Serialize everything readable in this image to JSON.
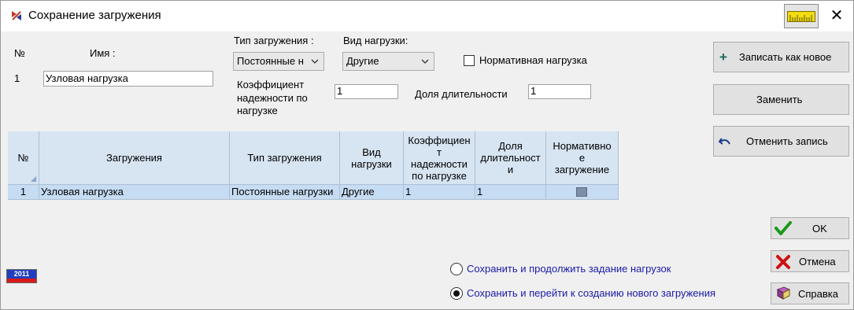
{
  "window": {
    "title": "Сохранение загружения",
    "close_glyph": "✕",
    "title_icon": "app-logo-icon",
    "ruler_icon": "ruler-icon"
  },
  "form": {
    "number_label": "№",
    "name_label": "Имя :",
    "row_number": "1",
    "name_value": "Узловая нагрузка",
    "load_type_label": "Тип загружения :",
    "load_type_value": "Постоянные н",
    "force_kind_label": "Вид нагрузки:",
    "force_kind_value": "Другие",
    "normative_label": "Нормативная нагрузка",
    "normative_checked": false,
    "reliability_label_1": "Коэффициент",
    "reliability_label_2": "надежности по",
    "reliability_label_3": "нагрузке",
    "reliability_value": "1",
    "duration_label": "Доля длительности",
    "duration_value": "1"
  },
  "grid": {
    "columns": [
      {
        "label": "№"
      },
      {
        "label": "Загружения"
      },
      {
        "label": "Тип загружения"
      },
      {
        "lines": [
          "Вид",
          "нагрузки"
        ]
      },
      {
        "lines": [
          "Коэффициен",
          "т",
          "надежности",
          "по нагрузке"
        ]
      },
      {
        "lines": [
          "Доля",
          "длительност",
          "и"
        ]
      },
      {
        "lines": [
          "Нормативно",
          "е",
          "загружение"
        ]
      }
    ],
    "rows": [
      {
        "num": "1",
        "name": "Узловая нагрузка",
        "type": "Постоянные нагрузки",
        "kind": "Другие",
        "reliability": "1",
        "duration": "1",
        "normative": false
      }
    ]
  },
  "buttons": {
    "save_new": "Записать как новое",
    "replace": "Заменить",
    "cancel_record": "Отменить запись",
    "ok": "OK",
    "cancel": "Отмена",
    "help": "Справка"
  },
  "radios": {
    "continue_label": "Сохранить и продолжить задание нагрузок",
    "new_label": "Сохранить и перейти к созданию нового загружения",
    "selected": "new"
  },
  "flag": {
    "text": "2011"
  },
  "colors": {
    "grid_header": "#d7e4f2",
    "grid_row": "#c5dcf3",
    "radio_text": "#1a1aa8",
    "ok_check": "#1a9a1a",
    "cancel_x": "#cc1111"
  }
}
